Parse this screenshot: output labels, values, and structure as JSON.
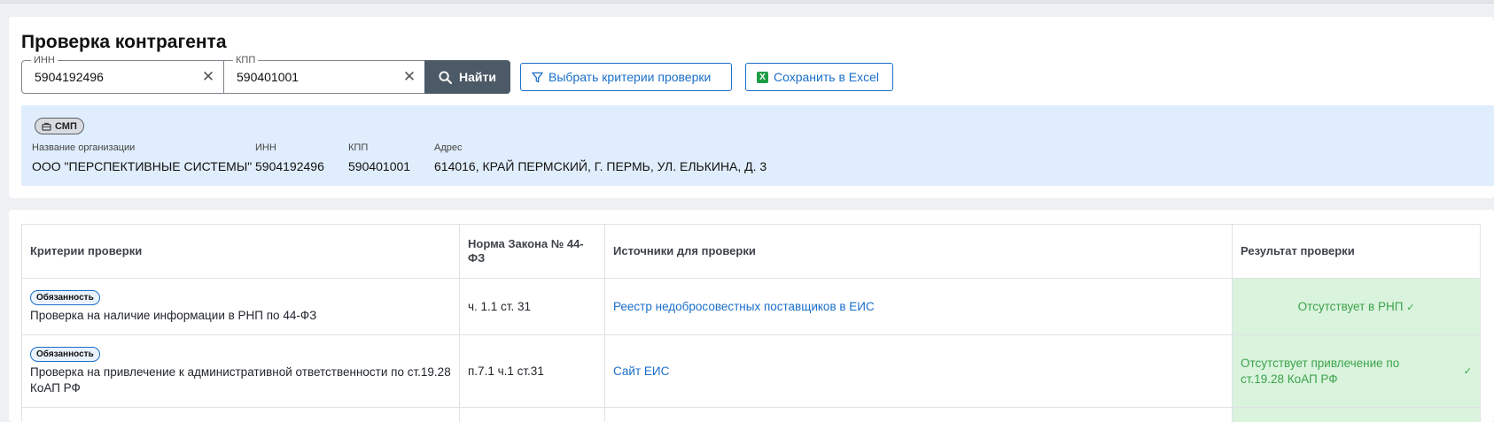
{
  "header": {
    "title": "Проверка контрагента"
  },
  "search": {
    "inn_label": "ИНН",
    "inn_value": "5904192496",
    "kpp_label": "КПП",
    "kpp_value": "590401001",
    "find_label": "Найти",
    "criteria_label": "Выбрать критерии проверки",
    "excel_label": "Сохранить в Excel"
  },
  "org": {
    "badge": "СМП",
    "fields": [
      {
        "label": "Название организации",
        "value": "ООО \"ПЕРСПЕКТИВНЫЕ СИСТЕМЫ\""
      },
      {
        "label": "ИНН",
        "value": "5904192496"
      },
      {
        "label": "КПП",
        "value": "590401001"
      },
      {
        "label": "Адрес",
        "value": "614016, КРАЙ ПЕРМСКИЙ, Г. ПЕРМЬ, УЛ. ЕЛЬКИНА, Д. 3"
      }
    ]
  },
  "table": {
    "columns": [
      "Критерии проверки",
      "Норма Закона № 44-ФЗ",
      "Источники для проверки",
      "Результат проверки"
    ],
    "rows": [
      {
        "badge": "Обязанность",
        "criterion": "Проверка на наличие информации в РНП по 44-ФЗ",
        "norm": "ч. 1.1 ст. 31",
        "source": "Реестр недобросовестных поставщиков в ЕИС",
        "result": "Отсутствует в РНП"
      },
      {
        "badge": "Обязанность",
        "criterion": "Проверка на привлечение к административной ответственности по ст.19.28 КоАП РФ",
        "norm": "п.7.1 ч.1 ст.31",
        "source": "Сайт ЕИС",
        "result": "Отсутствует привлечение по ст.19.28 КоАП РФ"
      }
    ]
  },
  "colors": {
    "accent": "#1a6fc9",
    "success_bg": "#d9f3dd",
    "success_text": "#3ca34b",
    "info_panel": "#e0edfc"
  },
  "icons": {
    "clear": "close-icon",
    "search": "search-icon",
    "filter": "filter-icon",
    "excel": "excel-icon",
    "check": "check-icon",
    "smp": "briefcase-icon"
  }
}
